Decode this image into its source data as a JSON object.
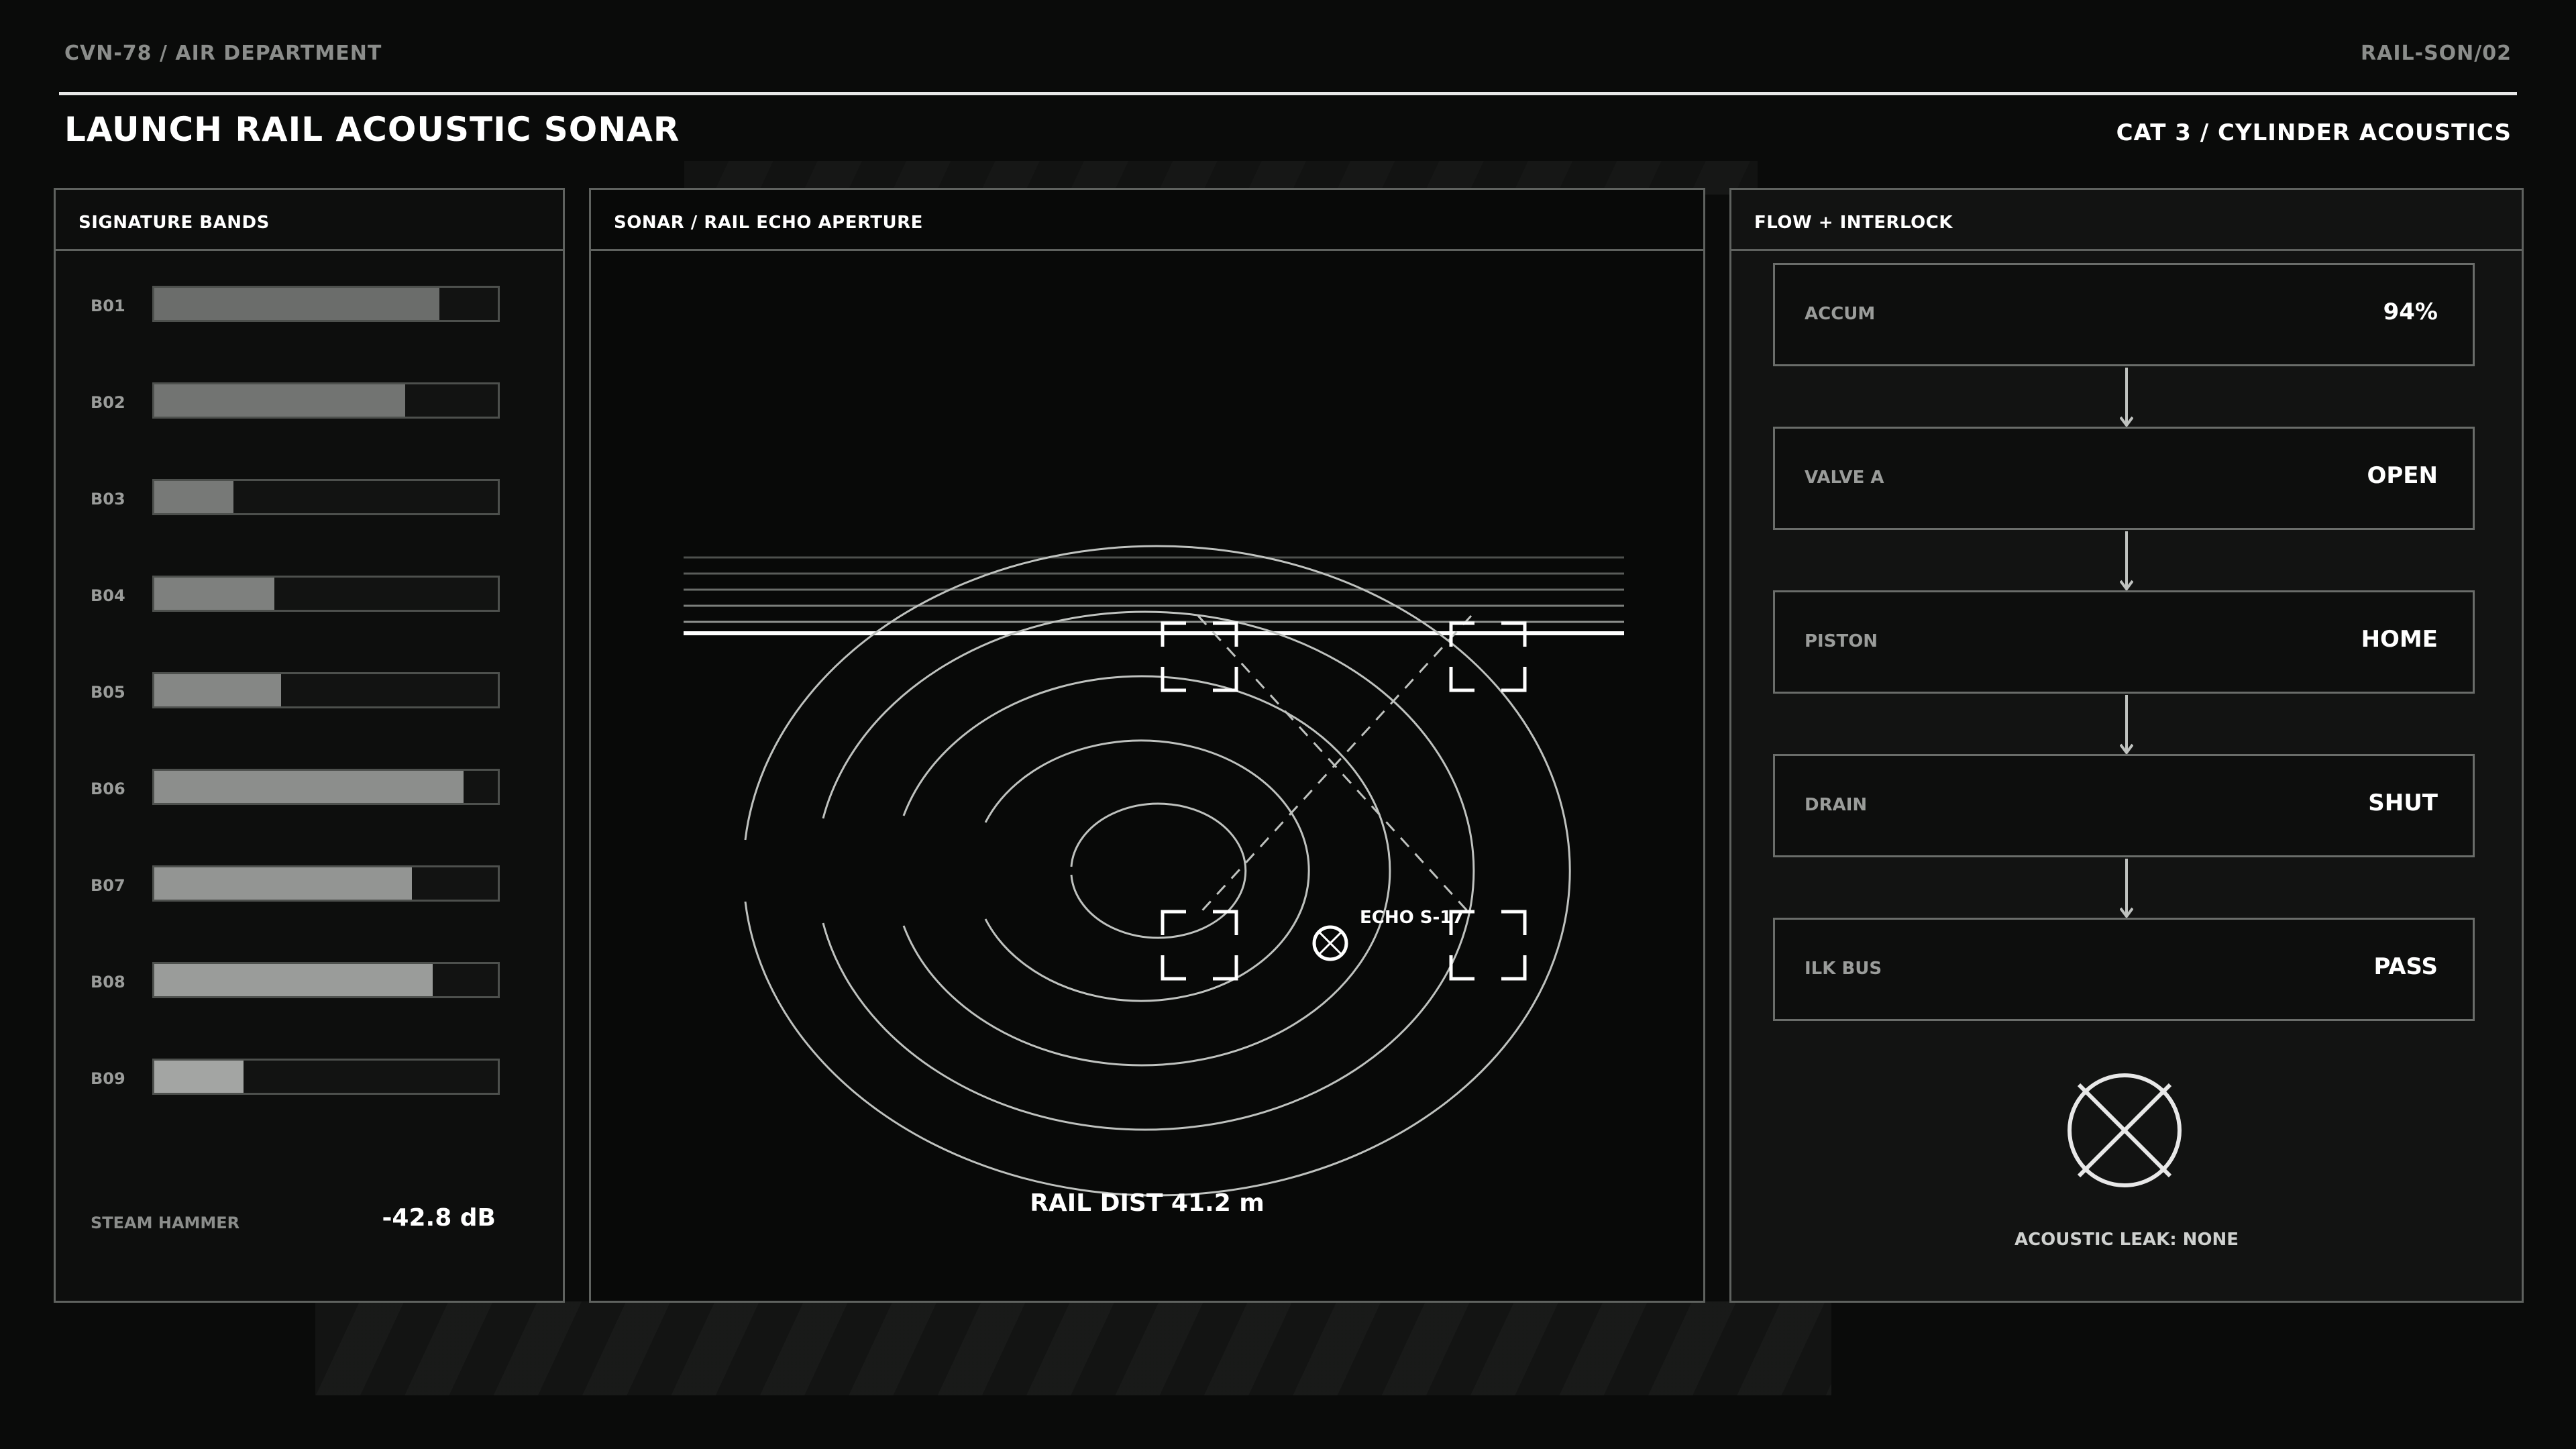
{
  "header": {
    "breadcrumb": "CVN-78 / AIR DEPARTMENT",
    "code": "RAIL-SON/02",
    "title": "LAUNCH RAIL ACOUSTIC SONAR",
    "subtitle": "CAT 3 / CYLINDER ACOUSTICS"
  },
  "bands_panel": {
    "title": "SIGNATURE BANDS",
    "bands": [
      {
        "label": "B01",
        "level": 0.83,
        "color": "#6b6d6b"
      },
      {
        "label": "B02",
        "level": 0.73,
        "color": "#727472"
      },
      {
        "label": "B03",
        "level": 0.23,
        "color": "#777977"
      },
      {
        "label": "B04",
        "level": 0.35,
        "color": "#7e807e"
      },
      {
        "label": "B05",
        "level": 0.37,
        "color": "#858785"
      },
      {
        "label": "B06",
        "level": 0.9,
        "color": "#8c8e8c"
      },
      {
        "label": "B07",
        "level": 0.75,
        "color": "#939593"
      },
      {
        "label": "B08",
        "level": 0.81,
        "color": "#9a9c9a"
      },
      {
        "label": "B09",
        "level": 0.26,
        "color": "#a3a5a3"
      }
    ],
    "steam_hammer_label": "STEAM HAMMER",
    "steam_hammer_value": "-42.8 dB"
  },
  "sonar_panel": {
    "title": "SONAR / RAIL ECHO APERTURE",
    "echo_label": "ECHO S-17",
    "rail_dist": "RAIL DIST 41.2 m"
  },
  "flow_panel": {
    "title": "FLOW + INTERLOCK",
    "items": [
      {
        "label": "ACCUM",
        "value": "94%"
      },
      {
        "label": "VALVE A",
        "value": "OPEN"
      },
      {
        "label": "PISTON",
        "value": "HOME"
      },
      {
        "label": "DRAIN",
        "value": "SHUT"
      },
      {
        "label": "ILK BUS",
        "value": "PASS"
      }
    ],
    "leak_icon": "x-circle-icon",
    "leak_status": "ACOUSTIC LEAK: NONE"
  }
}
